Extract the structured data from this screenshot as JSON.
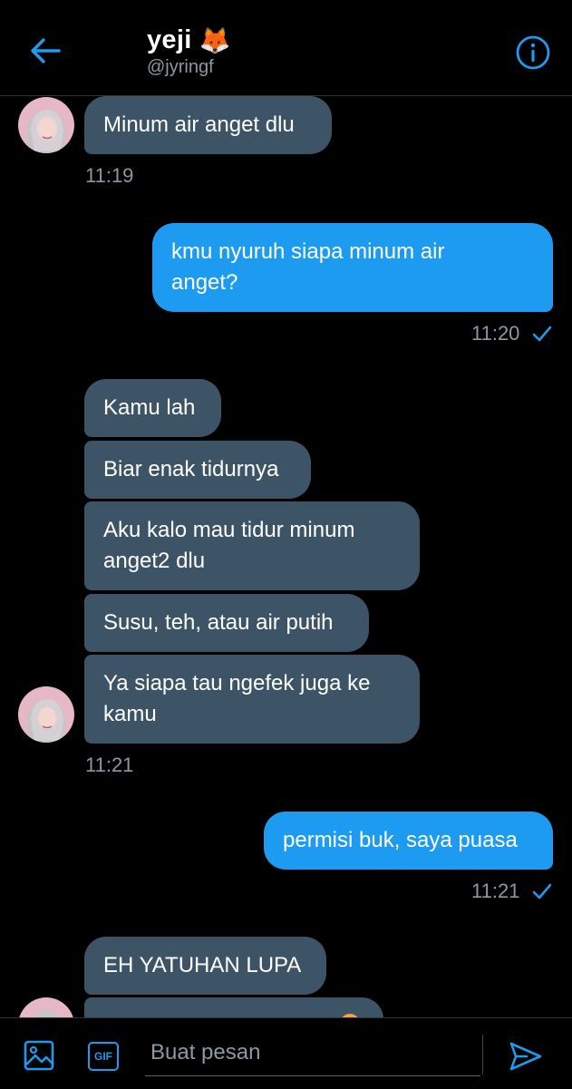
{
  "header": {
    "name": "yeji",
    "emoji": "🦊",
    "handle": "@jyringf"
  },
  "messages": [
    {
      "text": "Minum air anget dlu"
    },
    {
      "time": "11:19"
    },
    {
      "text1": "kmu nyuruh siapa minum air",
      "text2": "anget?"
    },
    {
      "time": "11:20"
    },
    {
      "text": "Kamu lah"
    },
    {
      "text": "Biar enak tidurnya"
    },
    {
      "text1": "Aku kalo mau tidur minum",
      "text2": "anget2 dlu"
    },
    {
      "text": "Susu, teh, atau air putih"
    },
    {
      "text1": "Ya siapa tau ngefek juga ke",
      "text2": "kamu"
    },
    {
      "time": "11:21"
    },
    {
      "text": "permisi buk, saya puasa"
    },
    {
      "time": "11:21"
    },
    {
      "text": "EH YATUHAN LUPA"
    }
  ],
  "composer": {
    "placeholder": "Buat pesan",
    "gif_label": "GIF"
  },
  "colors": {
    "accent": "#1d9bf0",
    "incoming_bubble": "#3d5466",
    "background": "#000000",
    "muted_text": "#8b98a5"
  },
  "icons": [
    "back-arrow-icon",
    "fox-emoji-icon",
    "info-icon",
    "read-check-icon",
    "image-icon",
    "gif-icon",
    "send-icon"
  ]
}
